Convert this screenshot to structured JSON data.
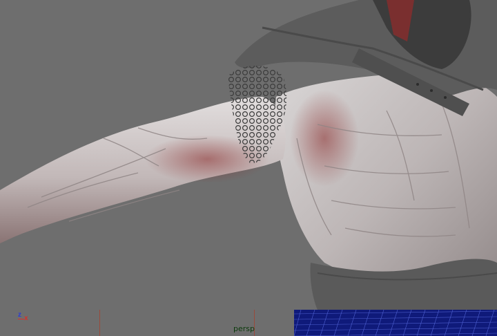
{
  "viewport": {
    "camera_name": "persp",
    "axis": {
      "z_label": "z",
      "x_label": "x"
    },
    "colors": {
      "background": "#6e6e6e",
      "mesh": "#1a1a8c",
      "skin": "#cfcfcf",
      "cloth": "#5a5a5a"
    }
  }
}
